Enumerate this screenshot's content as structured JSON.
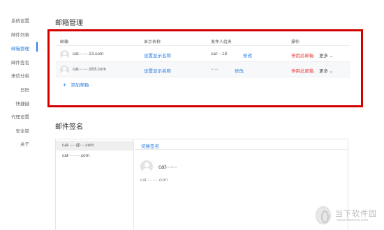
{
  "sidebar": {
    "items": [
      {
        "label": "系统设置"
      },
      {
        "label": "邮件列表"
      },
      {
        "label": "邮箱管理",
        "active": true
      },
      {
        "label": "邮件签名"
      },
      {
        "label": "来信分类"
      },
      {
        "label": "日历"
      },
      {
        "label": "快捷键"
      },
      {
        "label": "代理设置"
      },
      {
        "label": "安全锁"
      },
      {
        "label": "关于"
      }
    ]
  },
  "mailbox": {
    "title": "邮箱管理",
    "columns": [
      "邮箱",
      "显示名称",
      "发件人姓名",
      "操作"
    ],
    "rows": [
      {
        "email": "cat∙∙∙∙∙∙∙∙13.com",
        "display_name": "设置显示名称",
        "sender": "cat∙∙∙∙18",
        "edit": "修改",
        "disable": "停用此邮箱",
        "more": "更多 ⌄"
      },
      {
        "email": "cat∙∙∙∙∙∙∙∙163.com",
        "display_name": "设置显示名称",
        "sender": "∙∙∙∙∙∙",
        "edit": "修改",
        "disable": "停用此邮箱",
        "more": "更多 ⌄"
      }
    ],
    "add_label": "添加邮箱"
  },
  "signature": {
    "title": "邮件签名",
    "list": [
      {
        "label": "cat∙∙∙∙∙∙@∙∙∙.com"
      },
      {
        "label": "cat∙∙∙∙∙∙∙∙∙.com"
      }
    ],
    "switch_label": "切换签名",
    "name": "cat∙∙∙∙∙∙∙",
    "email": "cat∙∙∙∙∙∙∙∙∙.com"
  },
  "watermark": {
    "brand": "当下软件园",
    "sub": "www.downxia.com"
  },
  "colors": {
    "accent": "#2b7de1",
    "danger": "#e64340",
    "highlight_box": "#d40000"
  }
}
